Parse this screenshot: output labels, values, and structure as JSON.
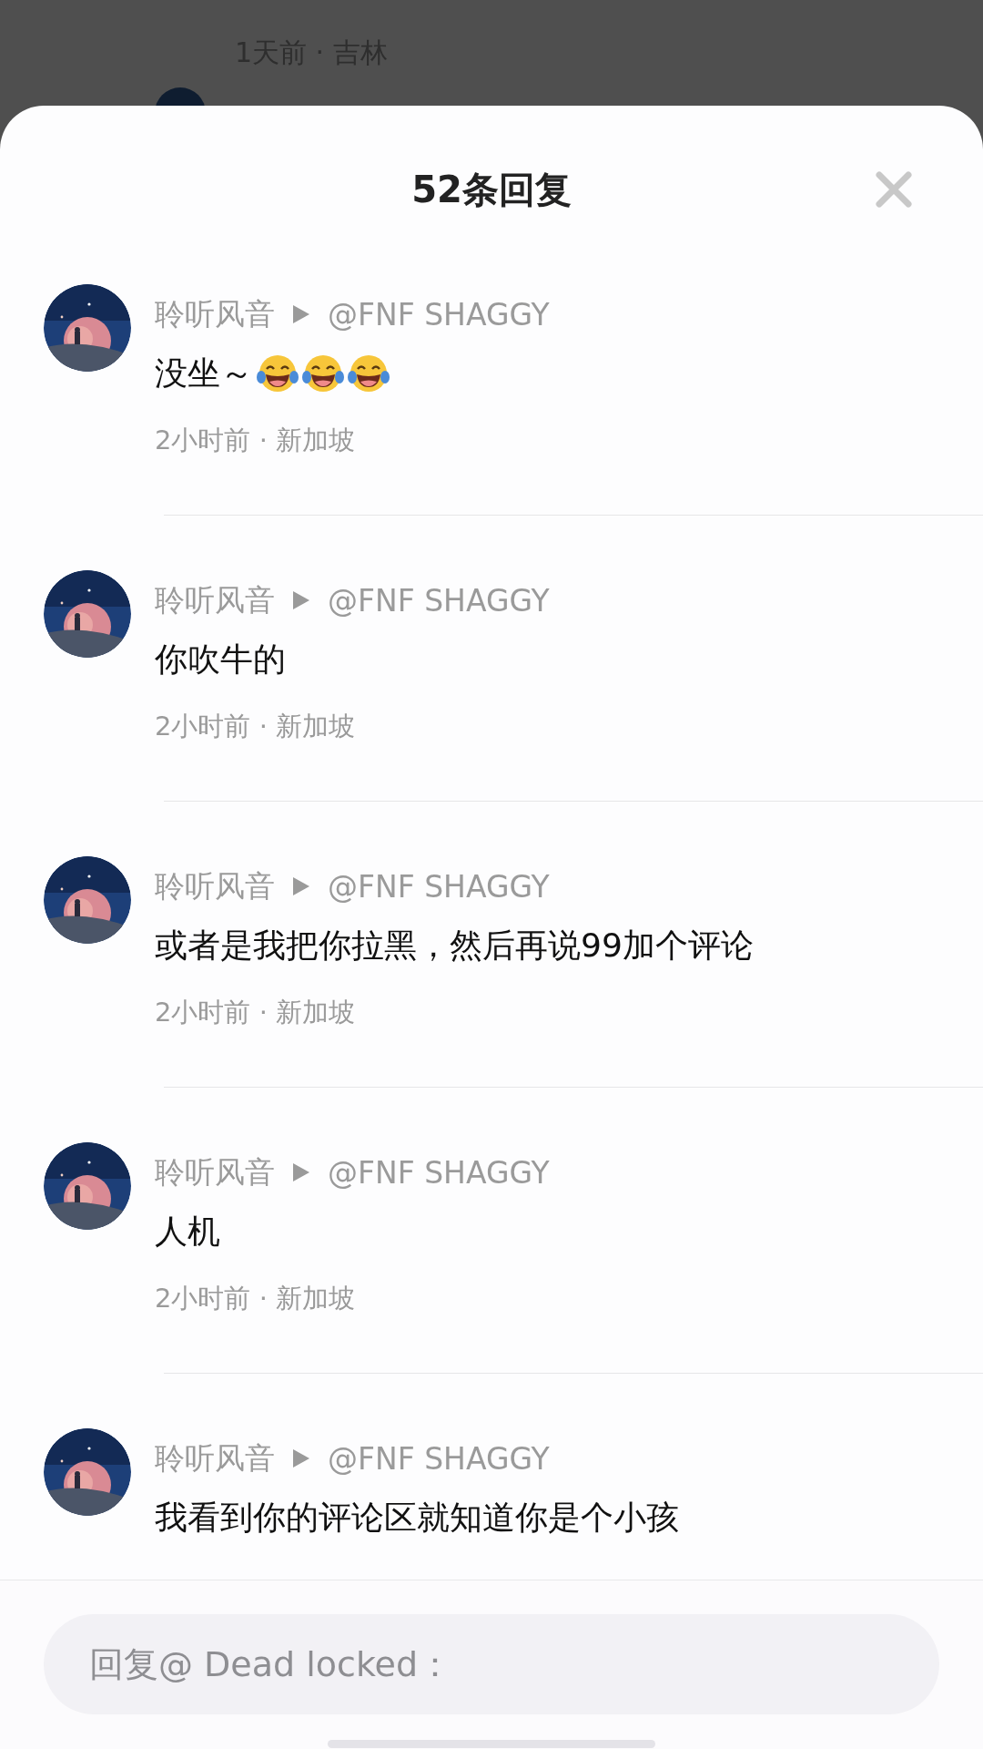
{
  "background": {
    "time_location": "1天前 · 吉林"
  },
  "sheet": {
    "title": "52条回复"
  },
  "comments": [
    {
      "author": "聆听风音",
      "reply_to": "@FNF SHAGGY",
      "text": "没坐～",
      "emojis": [
        {
          "kind": "laugh"
        },
        {
          "kind": "laugh"
        },
        {
          "kind": "laugh"
        }
      ],
      "meta": "2小时前 · 新加坡"
    },
    {
      "author": "聆听风音",
      "reply_to": "@FNF SHAGGY",
      "text": "你吹牛的",
      "meta": "2小时前 · 新加坡"
    },
    {
      "author": "聆听风音",
      "reply_to": "@FNF SHAGGY",
      "text": "或者是我把你拉黑，然后再说99加个评论",
      "meta": "2小时前 · 新加坡"
    },
    {
      "author": "聆听风音",
      "reply_to": "@FNF SHAGGY",
      "text": "人机",
      "meta": "2小时前 · 新加坡"
    },
    {
      "author": "聆听风音",
      "reply_to": "@FNF SHAGGY",
      "text": "我看到你的评论区就知道你是个小孩"
    }
  ],
  "reply_field": {
    "placeholder": "回复@ Dead locked："
  }
}
